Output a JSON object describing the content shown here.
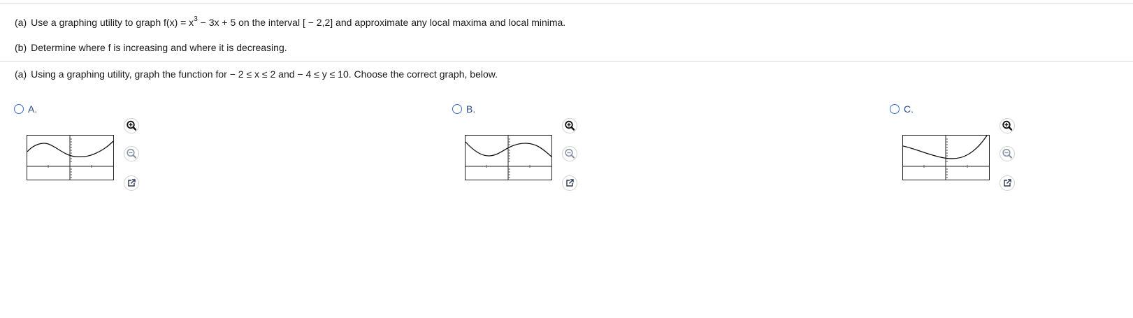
{
  "question": {
    "a_label": "(a)",
    "a_text_before": "Use a graphing utility to graph f(x) = x",
    "a_exponent": "3",
    "a_text_after": " − 3x + 5 on the interval [ − 2,2] and approximate any local maxima and local minima.",
    "b_label": "(b)",
    "b_text": "Determine where f is increasing and where it is decreasing."
  },
  "instruction": {
    "label": "(a)",
    "text": "Using a graphing utility, graph the function for  − 2 ≤ x ≤ 2 and  − 4 ≤ y ≤ 10.  Choose the correct graph, below."
  },
  "options": [
    {
      "letter": "A.",
      "selected": false,
      "graph": "cubic-up-then-down-then-up"
    },
    {
      "letter": "B.",
      "selected": false,
      "graph": "cubic-down-then-up-then-down"
    },
    {
      "letter": "C.",
      "selected": false,
      "graph": "decreasing-then-steep-increase"
    }
  ],
  "icons": {
    "zoom_in": "zoom-in-icon",
    "zoom_out": "zoom-out-icon",
    "popout": "popout-icon"
  },
  "colors": {
    "radio_border": "#3a6bc8",
    "option_label": "#2b4c8c",
    "tool_stroke": "#2b3a57"
  }
}
